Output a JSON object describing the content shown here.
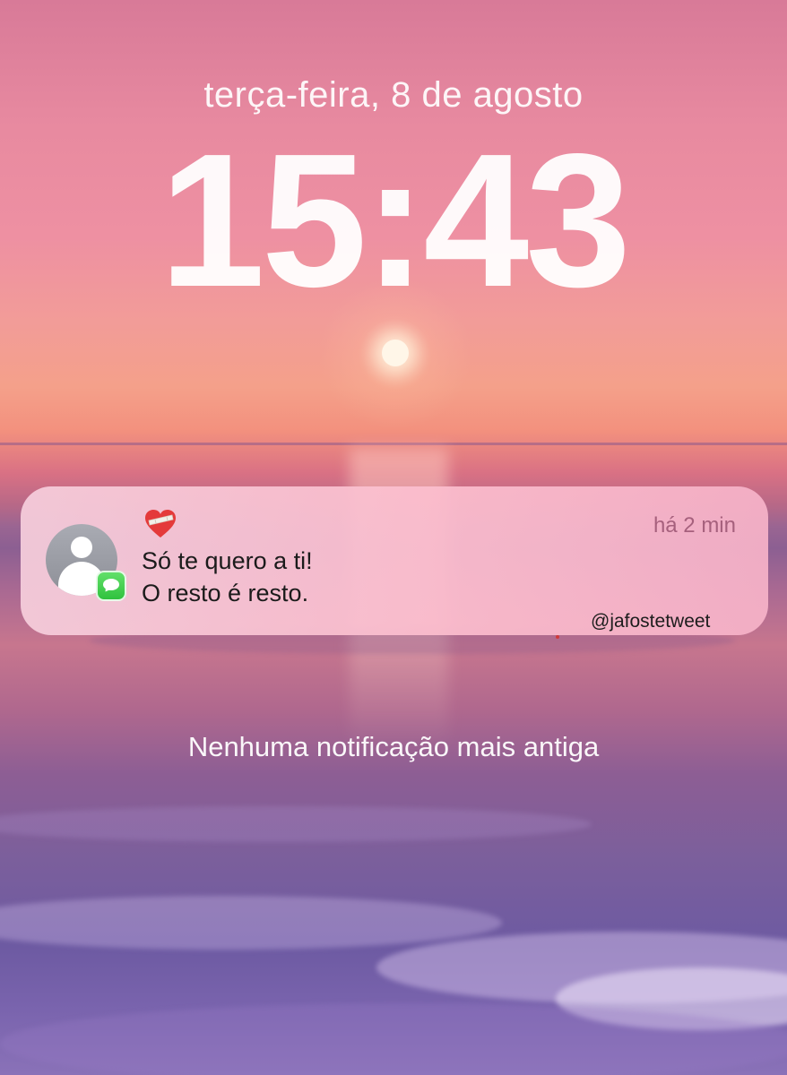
{
  "lock_screen": {
    "date": "terça-feira, 8 de agosto",
    "time": "15:43",
    "footer_message": "Nenhuma notificação mais antiga"
  },
  "notification": {
    "app": "messages-icon",
    "avatar": "default-contact-avatar",
    "emoji": "mending-heart-icon",
    "timestamp": "há 2 min",
    "line1": "Só te quero a ti!",
    "line2": "O resto é resto.",
    "accent_color": "#f7b8cc"
  },
  "watermark": {
    "handle": "@jafostetweet"
  }
}
